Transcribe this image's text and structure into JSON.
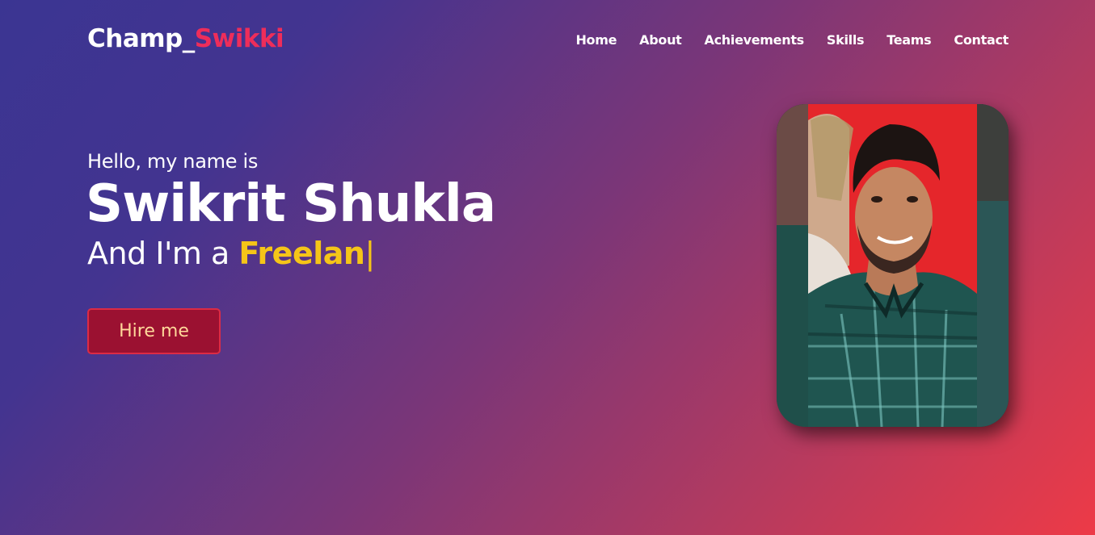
{
  "brand": {
    "name_part1": "Champ_",
    "name_part2": "Swikki",
    "accent_color": "#ee2d5a"
  },
  "nav": {
    "items": [
      {
        "label": "Home"
      },
      {
        "label": "About"
      },
      {
        "label": "Achievements"
      },
      {
        "label": "Skills"
      },
      {
        "label": "Teams"
      },
      {
        "label": "Contact"
      }
    ]
  },
  "hero": {
    "greeting": "Hello, my name is",
    "name": "Swikrit Shukla",
    "role_prefix": "And I'm a ",
    "role_typed": "Freelan",
    "cursor": "|",
    "typed_color": "#f5c518",
    "hire_button": "Hire me"
  },
  "profile_photo": {
    "icon": "profile-photo"
  },
  "colors": {
    "gradient_start": "#3b3592",
    "gradient_end": "#ed3a47",
    "button_bg": "#9b1131"
  }
}
